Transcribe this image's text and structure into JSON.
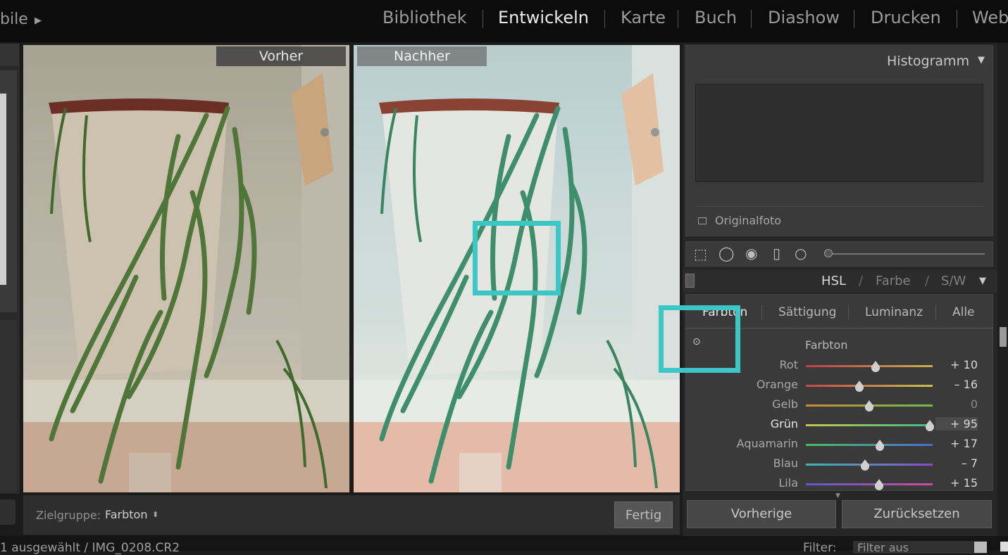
{
  "top_bar": {
    "left_fragment": "bile",
    "left_arrow_icon": "triangle-right-icon",
    "modules": [
      {
        "label": "Bibliothek",
        "active": false
      },
      {
        "label": "Entwickeln",
        "active": true
      },
      {
        "label": "Karte",
        "active": false
      },
      {
        "label": "Buch",
        "active": false
      },
      {
        "label": "Diashow",
        "active": false
      },
      {
        "label": "Drucken",
        "active": false
      },
      {
        "label": "Web",
        "active": false
      }
    ]
  },
  "compare": {
    "before_label": "Vorher",
    "after_label": "Nachher"
  },
  "toolbar": {
    "target_label": "Zielgruppe:",
    "target_value": "Farbton",
    "done_button": "Fertig"
  },
  "filmstrip": {
    "info": "1 ausgewählt / IMG_0208.CR2",
    "filter_label": "Filter:",
    "filter_value": "Filter aus"
  },
  "histogram": {
    "title": "Histogramm",
    "original_photo_label": "Originalfoto"
  },
  "hsl_panel": {
    "modes": [
      "HSL",
      "/",
      "Farbe",
      "/",
      "S/W"
    ],
    "sub_tabs": [
      "Farbton",
      "Sättigung",
      "Luminanz",
      "Alle"
    ],
    "section_title": "Farbton",
    "rows": [
      {
        "label": "Rot",
        "value": 10,
        "display": "+ 10",
        "gradient": [
          "#c23b4a",
          "#c9b04a"
        ]
      },
      {
        "label": "Orange",
        "value": -16,
        "display": "– 16",
        "gradient": [
          "#c8484a",
          "#c8c04a"
        ]
      },
      {
        "label": "Gelb",
        "value": 0,
        "display": "0",
        "gradient": [
          "#c88a3a",
          "#6fbf4a"
        ]
      },
      {
        "label": "Grün",
        "value": 95,
        "display": "+ 95",
        "gradient": [
          "#c9c34a",
          "#3dbd8a"
        ],
        "highlight": true
      },
      {
        "label": "Aquamarin",
        "value": 17,
        "display": "+ 17",
        "gradient": [
          "#4abf5a",
          "#4a6cd0"
        ]
      },
      {
        "label": "Blau",
        "value": -7,
        "display": "– 7",
        "gradient": [
          "#3ab9b0",
          "#8a4ad0"
        ]
      },
      {
        "label": "Lila",
        "value": 15,
        "display": "+ 15",
        "gradient": [
          "#5a5ad0",
          "#d04aa0"
        ]
      }
    ],
    "range": [
      -100,
      100
    ]
  },
  "bottom_buttons": {
    "previous": "Vorherige",
    "reset": "Zurücksetzen"
  },
  "colors": {
    "highlight_box": "#3cc6c6",
    "active_module": "#ececec",
    "inactive_module": "#9b9b9b"
  }
}
